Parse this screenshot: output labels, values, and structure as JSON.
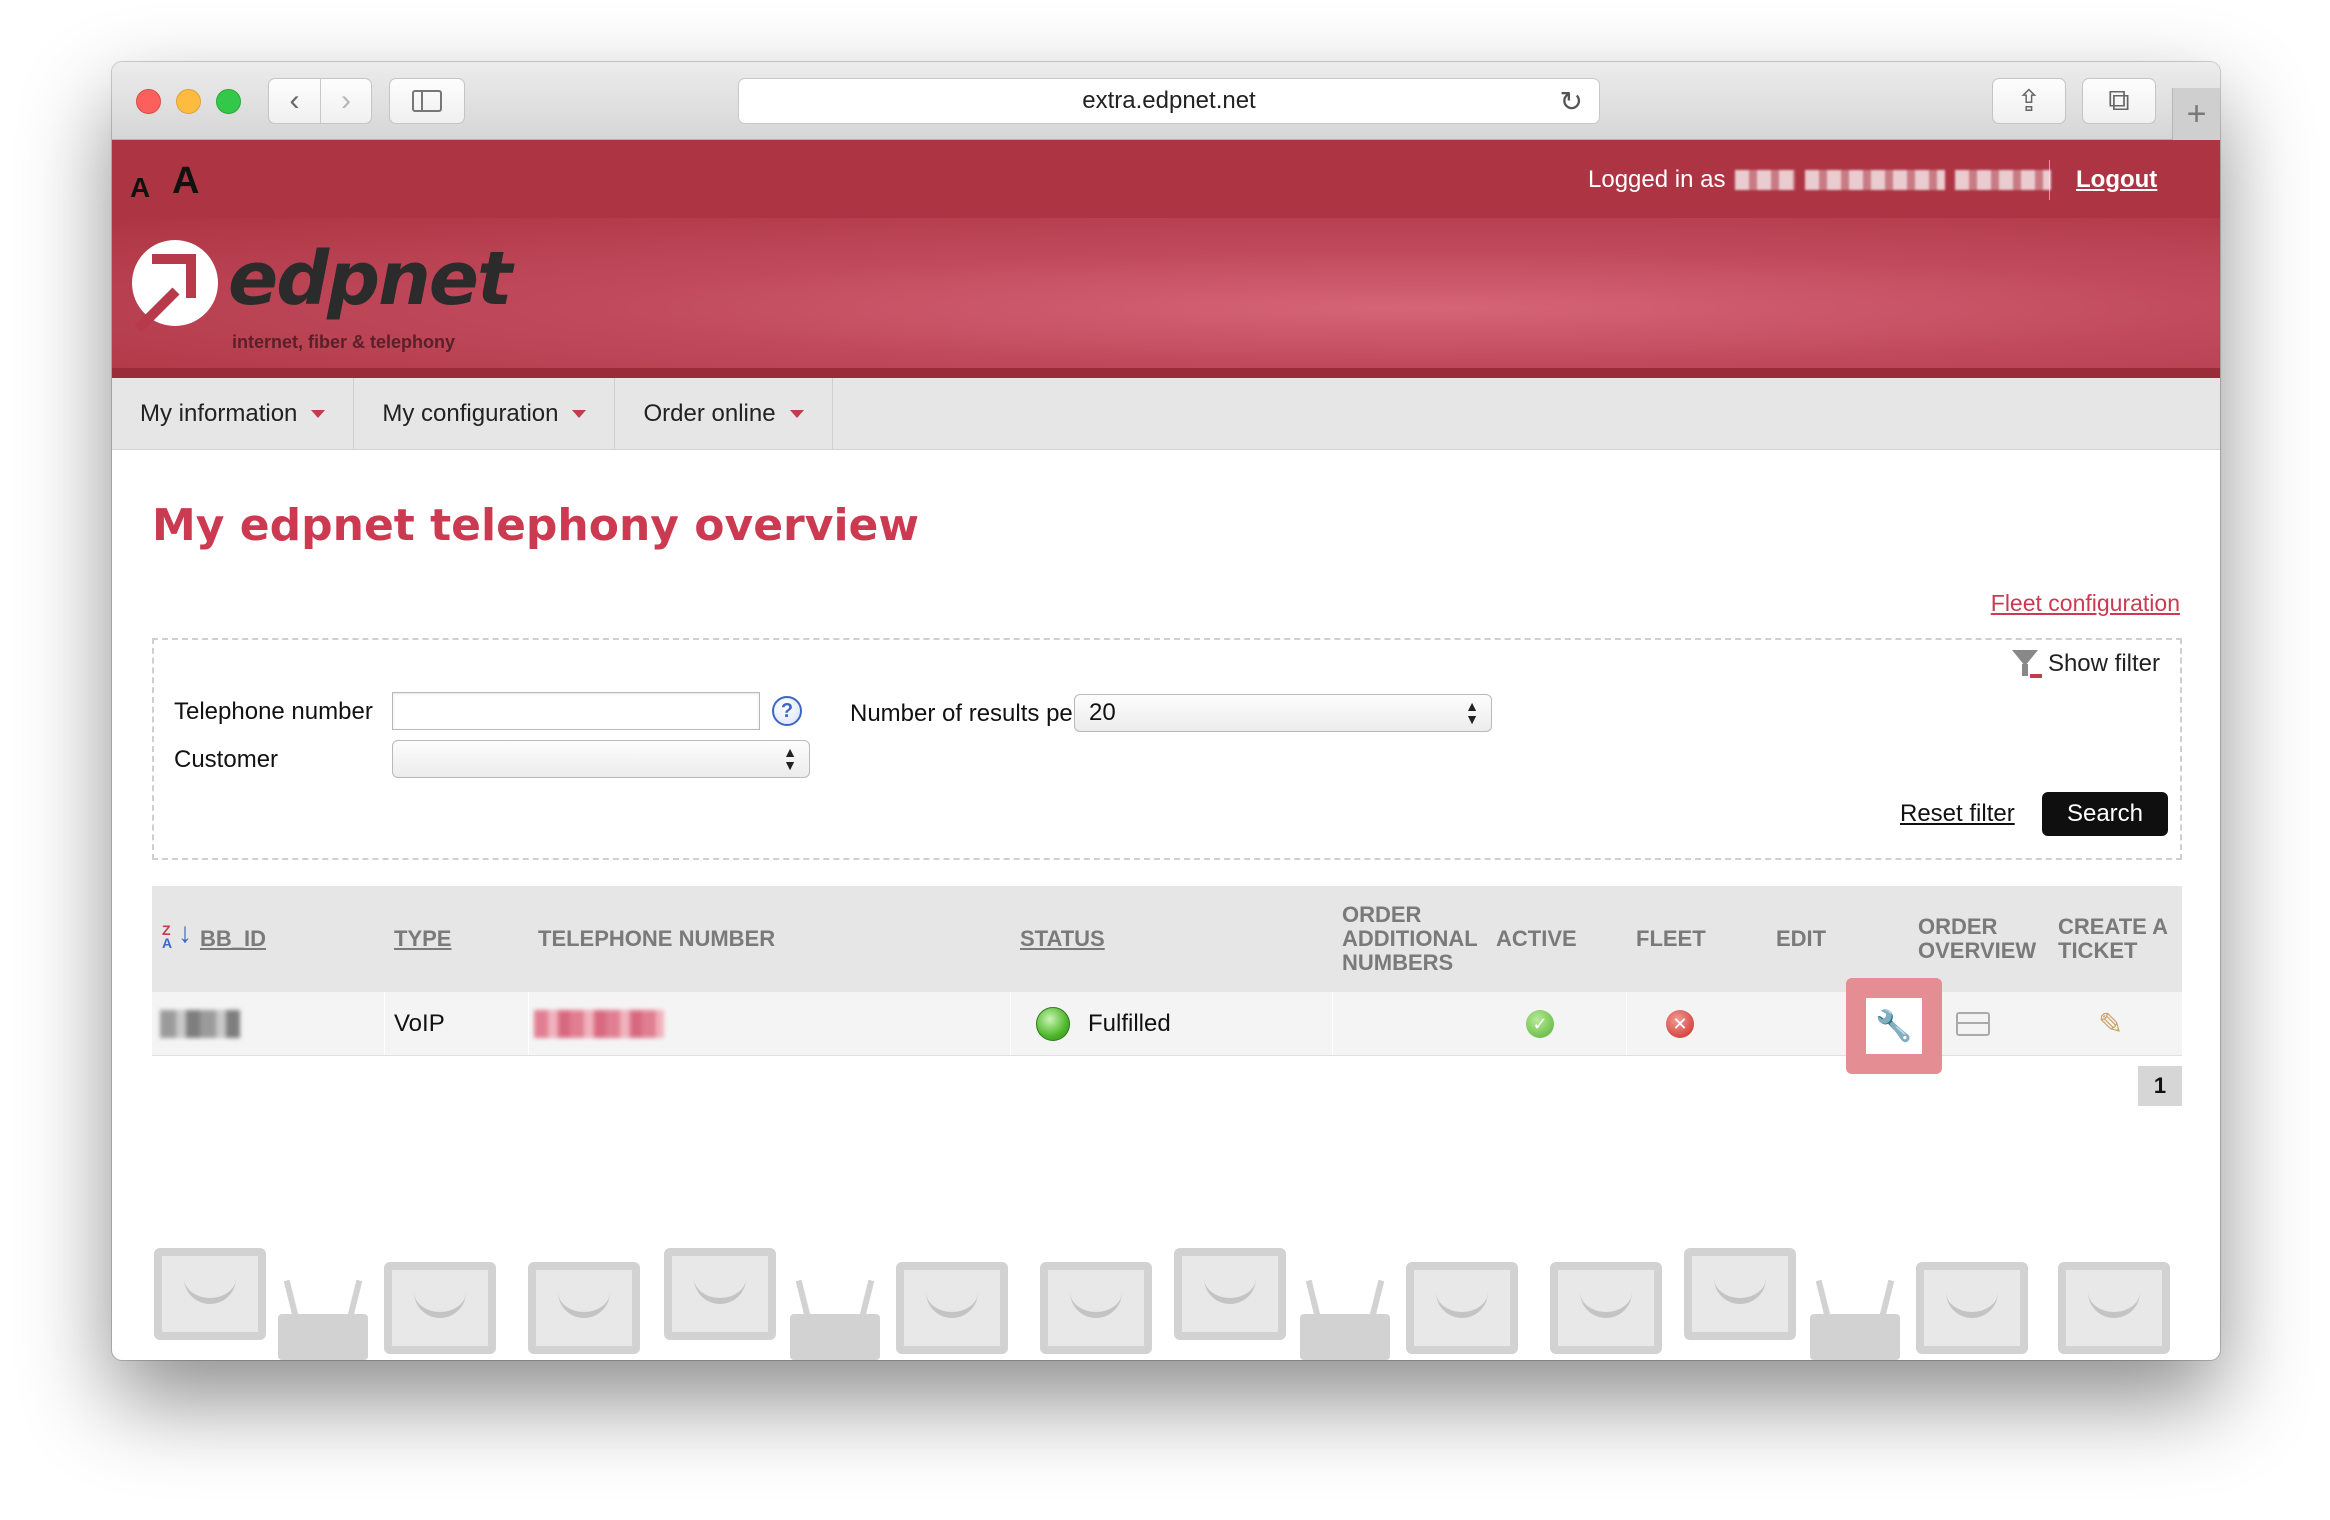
{
  "browser": {
    "url": "extra.edpnet.net",
    "back_glyph": "‹",
    "forward_glyph": "›",
    "reload_glyph": "↻",
    "share_glyph": "⇪",
    "tabs_glyph": "⧉",
    "new_tab_glyph": "+"
  },
  "topbar": {
    "font_small": "A",
    "font_large": "A",
    "logged_in_label": "Logged in as",
    "logout_label": "Logout"
  },
  "brand": {
    "name": "edpnet",
    "tagline": "internet, fiber & telephony",
    "color": "#cc3a51"
  },
  "menu": {
    "items": [
      {
        "label": "My information"
      },
      {
        "label": "My configuration"
      },
      {
        "label": "Order online"
      }
    ]
  },
  "page": {
    "title": "My edpnet telephony overview",
    "fleet_link": "Fleet configuration"
  },
  "filter": {
    "show_filter": "Show filter",
    "telephone_label": "Telephone number",
    "telephone_value": "",
    "customer_label": "Customer",
    "customer_value": "",
    "results_label": "Number of results pe",
    "results_value": "20",
    "help_glyph": "?",
    "reset_label": "Reset filter",
    "search_label": "Search"
  },
  "table": {
    "headers": {
      "bb_id": "BB_ID",
      "type": "TYPE",
      "telephone": "TELEPHONE NUMBER",
      "status": "STATUS",
      "order_additional_1": "ORDER",
      "order_additional_2": "ADDITIONAL",
      "order_additional_3": "NUMBERS",
      "active": "ACTIVE",
      "fleet": "FLEET",
      "edit": "EDIT",
      "order_overview_1": "ORDER",
      "order_overview_2": "OVERVIEW",
      "create_ticket_1": "CREATE A",
      "create_ticket_2": "TICKET"
    },
    "sort_glyph_top": "Z",
    "sort_glyph_bottom": "A",
    "sort_arrow": "↓",
    "rows": [
      {
        "type": "VoIP",
        "status": "Fulfilled",
        "active_glyph": "✓",
        "fleet_glyph": "✕",
        "edit_glyph": "🔧",
        "ticket_glyph": "✎"
      }
    ]
  },
  "pagination": {
    "current": "1"
  }
}
